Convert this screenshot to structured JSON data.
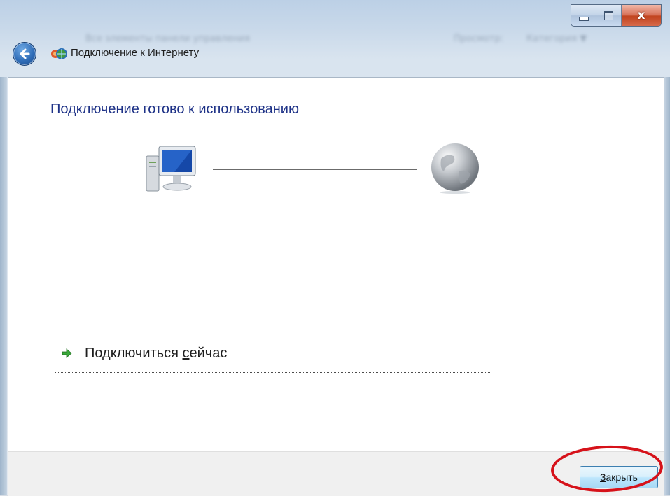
{
  "window": {
    "title": "Подключение к Интернету",
    "background_text": [
      "Все элементы панели управления",
      "Просмотр:",
      "Категория ▼"
    ]
  },
  "caption_buttons": {
    "minimize": "minimize-icon",
    "maximize": "maximize-icon",
    "close": "x"
  },
  "main": {
    "heading": "Подключение готово к использованию",
    "diagram": {
      "left": "computer-icon",
      "right": "internet-globe-icon"
    },
    "option": {
      "label_before": "Подключиться ",
      "label_underlined": "с",
      "label_after": "ейчас"
    }
  },
  "footer": {
    "close_prefix": "",
    "close_underlined": "З",
    "close_rest": "акрыть"
  },
  "colors": {
    "heading": "#1e3287",
    "annotation_ring": "#d6121a",
    "close_button_border": "#3c7fb1"
  }
}
